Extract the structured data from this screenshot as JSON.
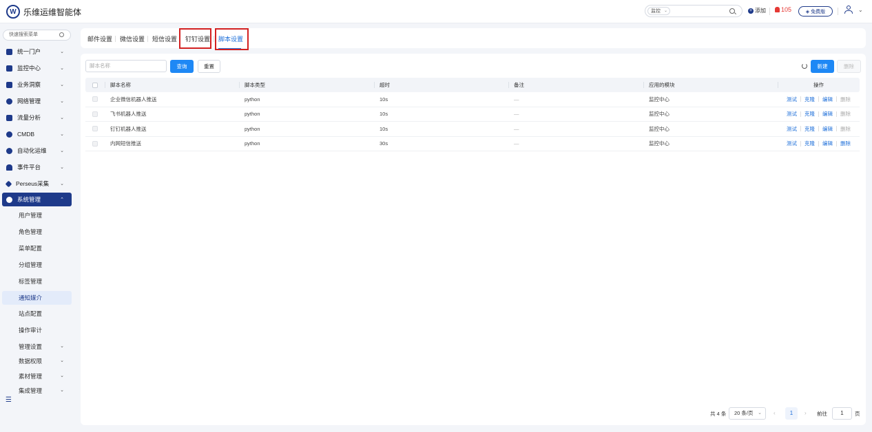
{
  "app": {
    "title": "乐维运维智能体",
    "logo_text": "W"
  },
  "header": {
    "search_scope": "监控",
    "add_label": "添加",
    "alert_count": "105",
    "free_badge": "免费版"
  },
  "sidebar": {
    "search_placeholder": "快速搜索菜单",
    "menu": [
      {
        "label": "统一门户"
      },
      {
        "label": "监控中心"
      },
      {
        "label": "业务洞察"
      },
      {
        "label": "网络管理"
      },
      {
        "label": "流量分析"
      },
      {
        "label": "CMDB"
      },
      {
        "label": "自动化运维"
      },
      {
        "label": "事件平台"
      },
      {
        "label": "Perseus采集"
      },
      {
        "label": "系统管理"
      }
    ],
    "sub_menu": [
      {
        "label": "用户管理"
      },
      {
        "label": "角色管理"
      },
      {
        "label": "菜单配置"
      },
      {
        "label": "分组管理"
      },
      {
        "label": "标签管理"
      },
      {
        "label": "通知媒介"
      },
      {
        "label": "站点配置"
      },
      {
        "label": "操作审计"
      },
      {
        "label": "管理设置"
      },
      {
        "label": "数据权限"
      },
      {
        "label": "素材管理"
      },
      {
        "label": "集成管理"
      }
    ]
  },
  "tabs": [
    {
      "label": "邮件设置"
    },
    {
      "label": "微信设置"
    },
    {
      "label": "短信设置"
    },
    {
      "label": "钉钉设置"
    },
    {
      "label": "脚本设置"
    }
  ],
  "toolbar": {
    "name_placeholder": "脚本名称",
    "query_label": "查询",
    "reset_label": "重置",
    "new_label": "新建",
    "delete_label": "删除"
  },
  "table": {
    "headers": [
      "脚本名称",
      "脚本类型",
      "超时",
      "备注",
      "应用的模块",
      "操作"
    ],
    "rows": [
      {
        "name": "企业微信机器人推送",
        "type": "python",
        "timeout": "10s",
        "note": "—",
        "module": "监控中心"
      },
      {
        "name": "飞书机器人推送",
        "type": "python",
        "timeout": "10s",
        "note": "—",
        "module": "监控中心"
      },
      {
        "name": "钉钉机器人推送",
        "type": "python",
        "timeout": "10s",
        "note": "—",
        "module": "监控中心"
      },
      {
        "name": "内网短信推送",
        "type": "python",
        "timeout": "30s",
        "note": "—",
        "module": "监控中心"
      }
    ],
    "ops": {
      "test": "测试",
      "clone": "克隆",
      "edit": "编辑",
      "delete": "删除"
    }
  },
  "pagination": {
    "total": "共 4 条",
    "page_size": "20 条/页",
    "current_page": "1",
    "goto_label": "前往",
    "goto_value": "1",
    "page_suffix": "页"
  }
}
